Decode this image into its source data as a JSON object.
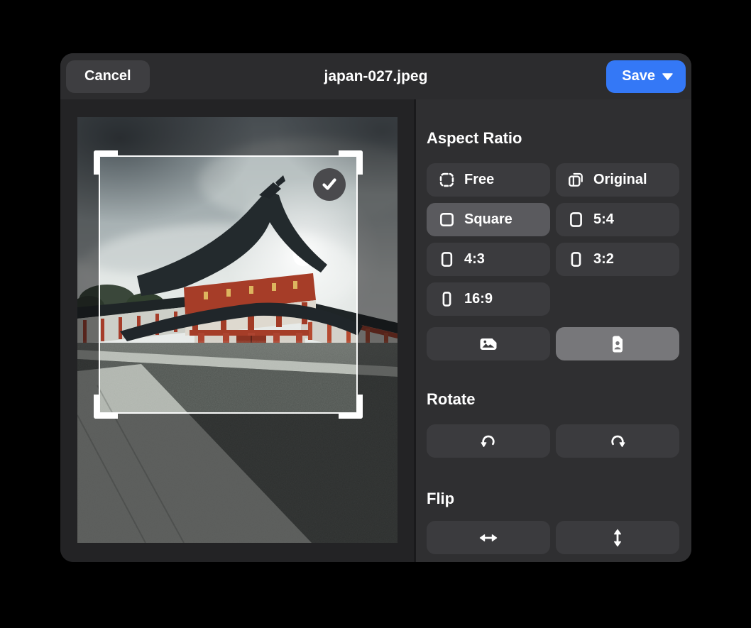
{
  "titlebar": {
    "cancel_label": "Cancel",
    "filename": "japan-027.jpeg",
    "save_label": "Save",
    "save_caret_icon": "caret-down-icon"
  },
  "preview": {
    "checkmark_icon": "checkmark-icon",
    "crop_handles": [
      "top-left",
      "top-right",
      "bottom-left",
      "bottom-right"
    ]
  },
  "panel": {
    "aspect_heading": "Aspect Ratio",
    "aspect_options": [
      {
        "label": "Free",
        "icon": "free-marquee-icon",
        "selected": false
      },
      {
        "label": "Original",
        "icon": "original-frames-icon",
        "selected": false
      },
      {
        "label": "Square",
        "icon": "square-ratio-icon",
        "selected": true
      },
      {
        "label": "5:4",
        "icon": "ratio-5-4-icon",
        "selected": false
      },
      {
        "label": "4:3",
        "icon": "ratio-4-3-icon",
        "selected": false
      },
      {
        "label": "3:2",
        "icon": "ratio-3-2-icon",
        "selected": false
      },
      {
        "label": "16:9",
        "icon": "ratio-16-9-icon",
        "selected": false
      }
    ],
    "orientation": {
      "landscape_icon": "landscape-photo-icon",
      "landscape_selected": false,
      "portrait_icon": "portrait-photo-icon",
      "portrait_selected": true
    },
    "rotate_heading": "Rotate",
    "rotate_buttons": [
      {
        "icon": "rotate-counterclockwise-icon"
      },
      {
        "icon": "rotate-clockwise-icon"
      }
    ],
    "flip_heading": "Flip",
    "flip_buttons": [
      {
        "icon": "flip-horizontal-icon"
      },
      {
        "icon": "flip-vertical-icon"
      }
    ]
  },
  "colors": {
    "page_bg": "#000000",
    "dialog_bg": "#2c2c2e",
    "canvas_bg": "#232325",
    "panel_bg": "#2f2f31",
    "button_bg": "#3b3b3e",
    "button_selected_bg": "#5a5a5e",
    "orientation_selected_bg": "#77777a",
    "accent_blue": "#3478f6",
    "check_badge_bg": "#4a4a4d"
  }
}
